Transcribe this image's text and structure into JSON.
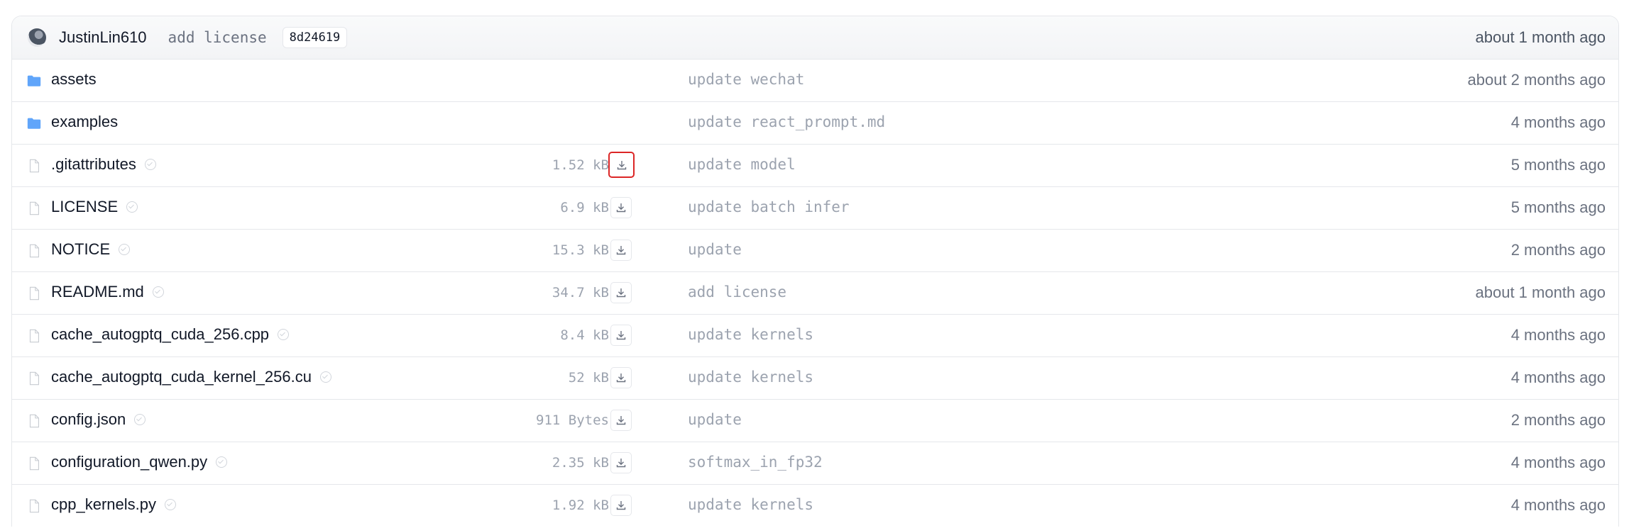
{
  "last_commit": {
    "author": "JustinLin610",
    "message": "add license",
    "hash": "8d24619",
    "time": "about 1 month ago"
  },
  "colors": {
    "folder": "#60a5fa",
    "highlight": "#dc2626"
  },
  "files": [
    {
      "type": "folder",
      "icon": "folder-icon",
      "name": "assets",
      "size": "",
      "message": "update wechat",
      "time": "about 2 months ago"
    },
    {
      "type": "folder",
      "icon": "folder-icon",
      "name": "examples",
      "size": "",
      "message": "update react_prompt.md",
      "time": "4 months ago"
    },
    {
      "type": "file",
      "icon": "file-icon",
      "name": ".gitattributes",
      "size": "1.52 kB",
      "message": "update model",
      "time": "5 months ago"
    },
    {
      "type": "file",
      "icon": "file-icon",
      "name": "LICENSE",
      "size": "6.9 kB",
      "message": "update batch infer",
      "time": "5 months ago"
    },
    {
      "type": "file",
      "icon": "file-icon",
      "name": "NOTICE",
      "size": "15.3 kB",
      "message": "update",
      "time": "2 months ago"
    },
    {
      "type": "file",
      "icon": "file-icon",
      "name": "README.md",
      "size": "34.7 kB",
      "message": "add license",
      "time": "about 1 month ago"
    },
    {
      "type": "file",
      "icon": "file-icon",
      "name": "cache_autogptq_cuda_256.cpp",
      "size": "8.4 kB",
      "message": "update kernels",
      "time": "4 months ago"
    },
    {
      "type": "file",
      "icon": "file-icon",
      "name": "cache_autogptq_cuda_kernel_256.cu",
      "size": "52 kB",
      "message": "update kernels",
      "time": "4 months ago"
    },
    {
      "type": "file",
      "icon": "file-icon",
      "name": "config.json",
      "size": "911 Bytes",
      "message": "update",
      "time": "2 months ago"
    },
    {
      "type": "file",
      "icon": "file-icon",
      "name": "configuration_qwen.py",
      "size": "2.35 kB",
      "message": "softmax_in_fp32",
      "time": "4 months ago"
    },
    {
      "type": "file",
      "icon": "file-icon",
      "name": "cpp_kernels.py",
      "size": "1.92 kB",
      "message": "update kernels",
      "time": "4 months ago"
    }
  ]
}
